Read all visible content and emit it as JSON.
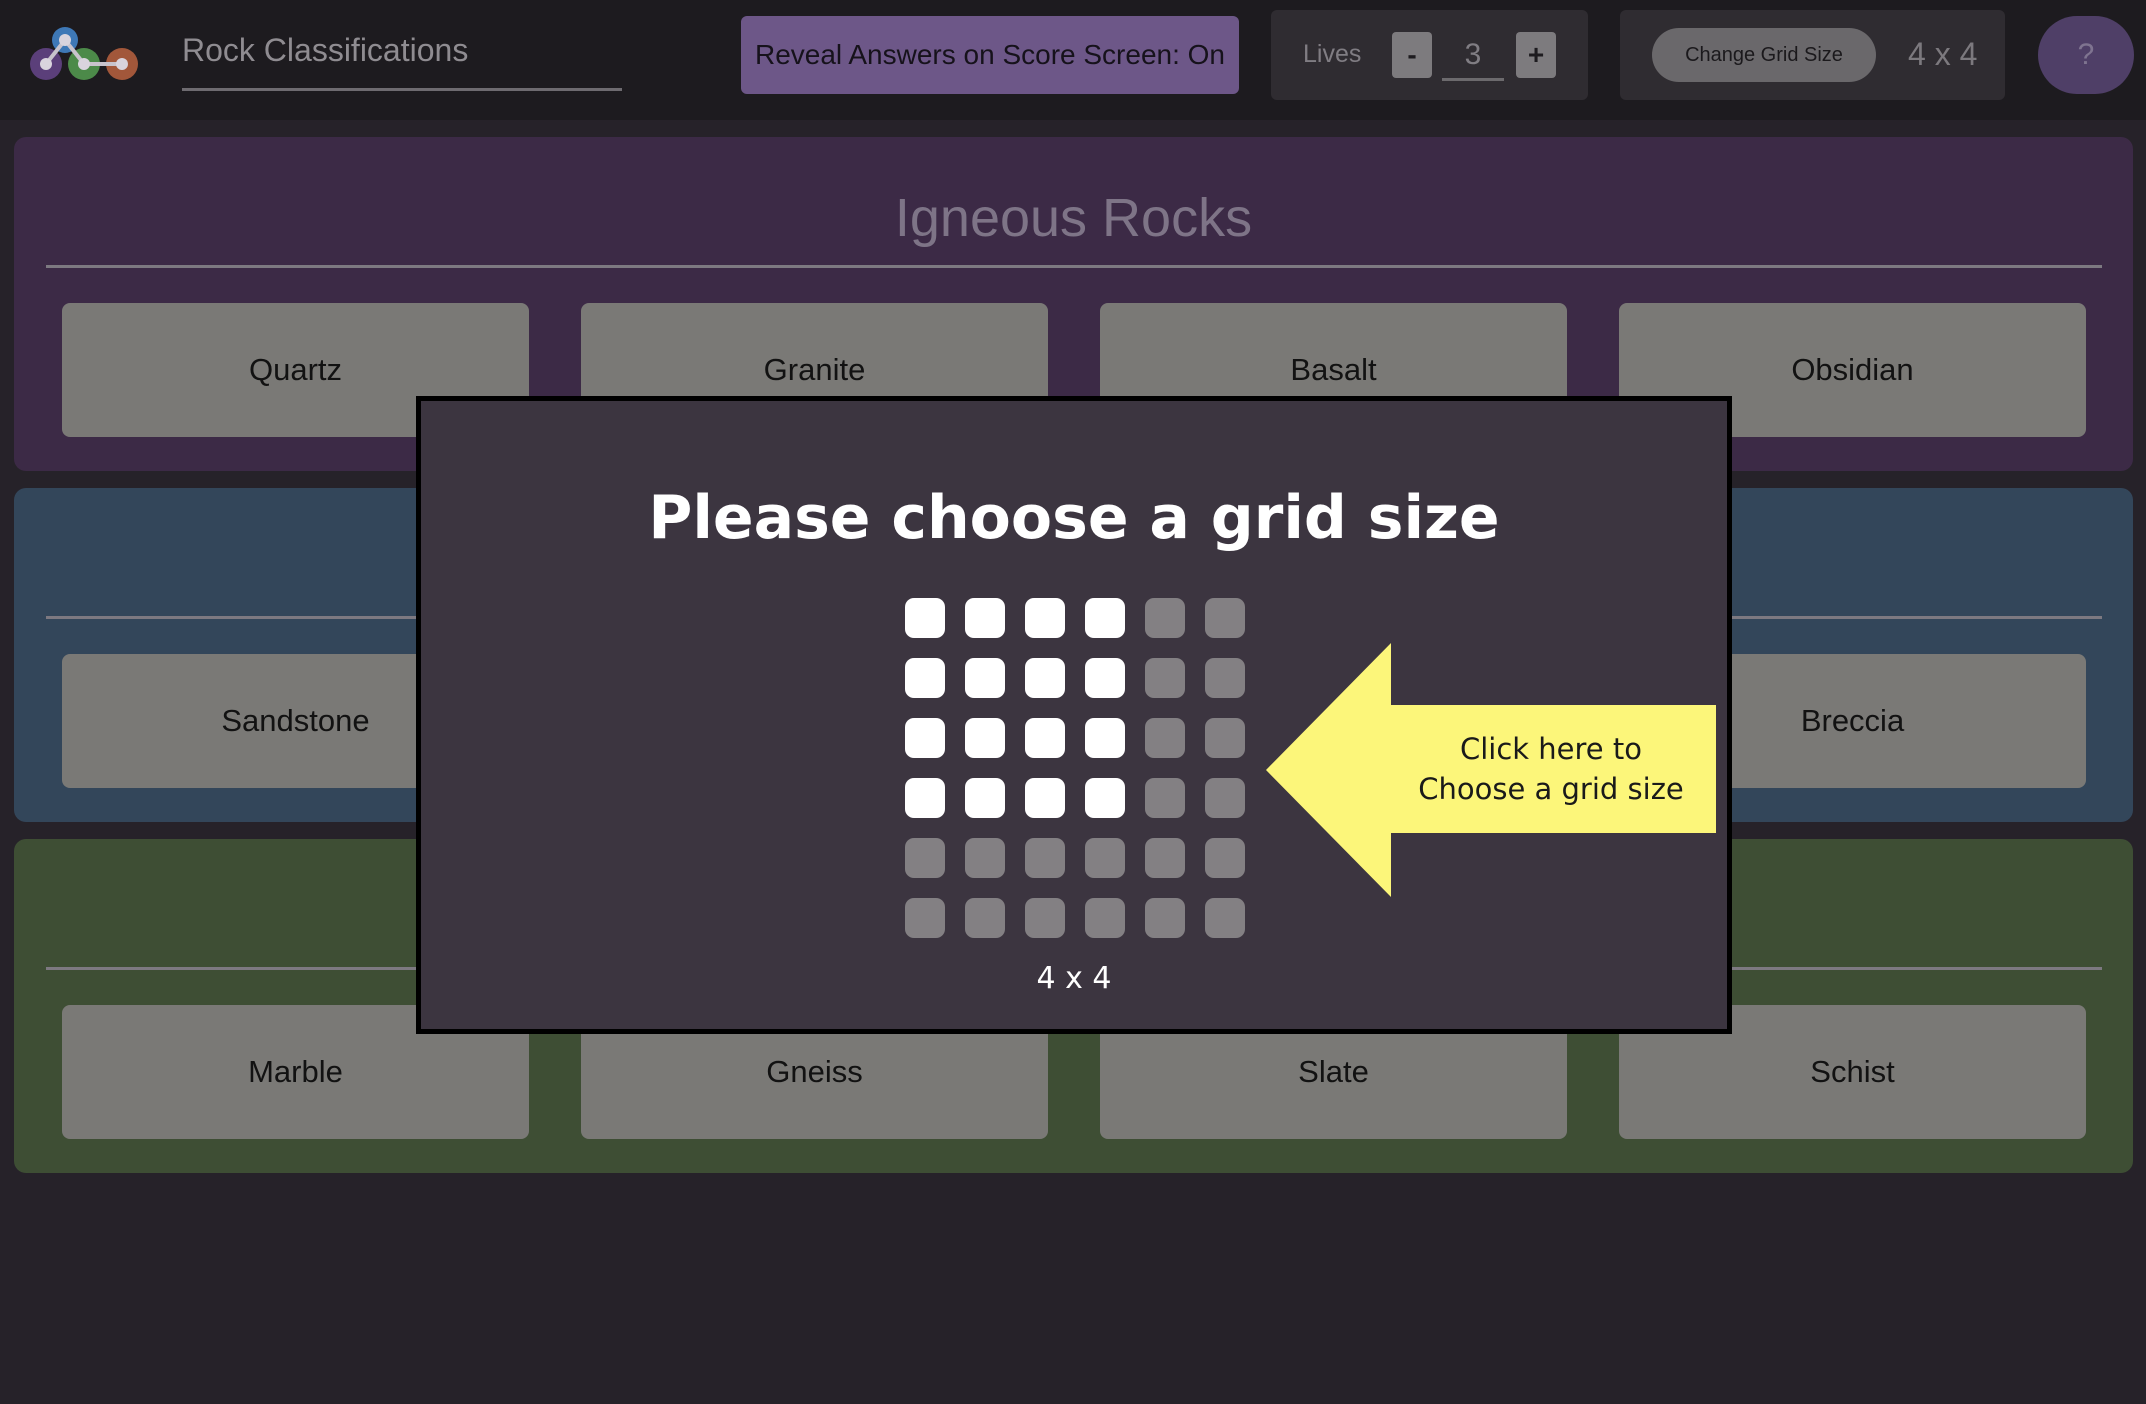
{
  "header": {
    "title": "Rock Classifications",
    "reveal_label": "Reveal Answers on Score Screen: On",
    "lives_label": "Lives",
    "lives_minus": "-",
    "lives_value": "3",
    "lives_plus": "+",
    "change_grid_label": "Change Grid Size",
    "grid_size": "4 x 4",
    "help_label": "?"
  },
  "categories": [
    {
      "title": "Igneous Rocks",
      "color": "#3c2a46",
      "items": [
        "Quartz",
        "Granite",
        "Basalt",
        "Obsidian"
      ]
    },
    {
      "title": "",
      "color": "#33465a",
      "items": [
        "Sandstone",
        "",
        "",
        "Breccia"
      ]
    },
    {
      "title": "",
      "color": "#3e4e34",
      "items": [
        "Marble",
        "Gneiss",
        "Slate",
        "Schist"
      ]
    }
  ],
  "modal": {
    "title": "Please choose a grid size",
    "selected_rows": 4,
    "selected_cols": 4,
    "max_rows": 6,
    "max_cols": 6,
    "grid_label": "4 x 4",
    "hint_line1": "Click here to",
    "hint_line2": "Choose a grid size",
    "hint_color": "#fcf67a"
  },
  "colors": {
    "logo_purple": "#5b3f7a",
    "logo_green": "#4c8a49",
    "logo_orange": "#a2573a",
    "logo_blue": "#3e78b6"
  }
}
